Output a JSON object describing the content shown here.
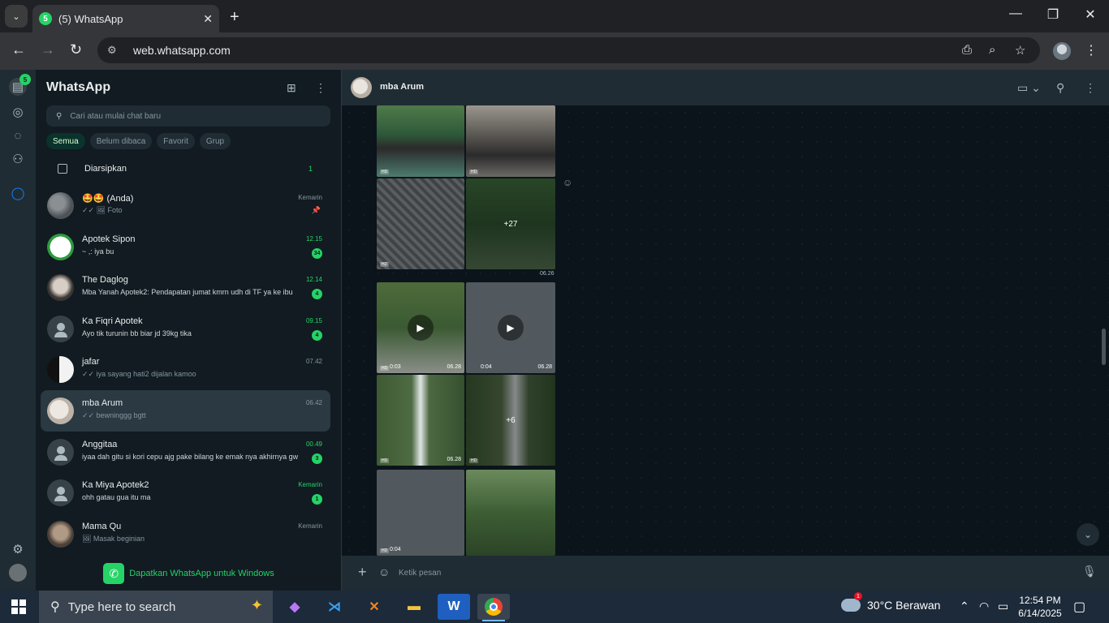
{
  "browser": {
    "tab_title": "(5) WhatsApp",
    "tab_badge": "5",
    "url": "web.whatsapp.com"
  },
  "rail": {
    "unread_badge": "5"
  },
  "sidebar": {
    "title": "WhatsApp",
    "search_placeholder": "Cari atau mulai chat baru",
    "filters": [
      "Semua",
      "Belum dibaca",
      "Favorit",
      "Grup"
    ],
    "archived_label": "Diarsipkan",
    "archived_count": "1",
    "chats": [
      {
        "name": "🤩🤩 (Anda)",
        "message": "✓✓ 🖼 Foto",
        "time": "Kemarin",
        "badge": "",
        "pinned": true
      },
      {
        "name": "Apotek Sipon",
        "message": "~ ,: iya bu",
        "time": "12.15",
        "badge": "34"
      },
      {
        "name": "The Daglog",
        "message": "Mba Yanah Apotek2: Pendapatan jumat kmrn udh di TF ya ke ibu",
        "time": "12.14",
        "badge": "4"
      },
      {
        "name": "Ka Fiqri Apotek",
        "message": "Ayo tik turunin bb biar jd 39kg tika",
        "time": "09.15",
        "badge": "4"
      },
      {
        "name": "jafar",
        "message": "✓✓ iya sayang hati2 dijalan kamoo",
        "time": "07.42",
        "badge": ""
      },
      {
        "name": "mba Arum",
        "message": "✓✓ bewninggg bgtt",
        "time": "06.42",
        "badge": ""
      },
      {
        "name": "Anggitaa",
        "message": "iyaa dah gitu si kori cepu ajg pake bilang ke emak nya akhirnya gw",
        "time": "00.49",
        "badge": "3"
      },
      {
        "name": "Ka Miya Apotek2",
        "message": "ohh gatau gua itu ma",
        "time": "Kemarin",
        "badge": "1"
      },
      {
        "name": "Mama Qu",
        "message": "🖼 Masak beginian",
        "time": "Kemarin",
        "badge": ""
      }
    ],
    "get_windows": "Dapatkan WhatsApp untuk Windows"
  },
  "conversation": {
    "contact": "mba Arum",
    "album1_more": "+27",
    "album1_time": "06.26",
    "album2_more": "+6",
    "video1_duration": "0:03",
    "video1_time": "06.28",
    "video2_duration": "0:04",
    "video2_time": "06.28",
    "photo_time": "06.28",
    "album3_duration": "0:04",
    "hd": "HD",
    "composer_placeholder": "Ketik pesan"
  },
  "taskbar": {
    "search_placeholder": "Type here to search",
    "weather": "30°C  Berawan",
    "weather_alert": "1",
    "time": "12:54 PM",
    "date": "6/14/2025"
  }
}
